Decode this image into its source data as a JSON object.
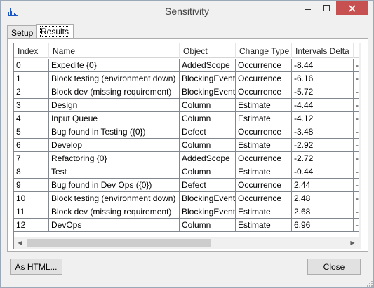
{
  "window": {
    "title": "Sensitivity",
    "icon": "bar-chart-app-icon",
    "controls": {
      "minimize": "minimize-icon",
      "maximize": "maximize-icon",
      "close": "close-icon"
    }
  },
  "tabs": [
    {
      "label": "Setup",
      "selected": false
    },
    {
      "label": "Results",
      "selected": true
    }
  ],
  "table": {
    "columns": [
      "Index",
      "Name",
      "Object",
      "Change Type",
      "Intervals Delta",
      ""
    ],
    "rows": [
      [
        "0",
        "Expedite {0}",
        "AddedScope",
        "Occurrence",
        "-8.44",
        "-"
      ],
      [
        "1",
        "Block testing (environment down)",
        "BlockingEvent",
        "Occurrence",
        "-6.16",
        "-"
      ],
      [
        "2",
        "Block dev (missing requirement)",
        "BlockingEvent",
        "Occurrence",
        "-5.72",
        "-"
      ],
      [
        "3",
        "Design",
        "Column",
        "Estimate",
        "-4.44",
        "-"
      ],
      [
        "4",
        "Input Queue",
        "Column",
        "Estimate",
        "-4.12",
        "-"
      ],
      [
        "5",
        "Bug found in Testing ({0})",
        "Defect",
        "Occurrence",
        "-3.48",
        "-"
      ],
      [
        "6",
        "Develop",
        "Column",
        "Estimate",
        "-2.92",
        "-"
      ],
      [
        "7",
        "Refactoring {0}",
        "AddedScope",
        "Occurrence",
        "-2.72",
        "-"
      ],
      [
        "8",
        "Test",
        "Column",
        "Estimate",
        "-0.44",
        "-"
      ],
      [
        "9",
        "Bug found in Dev Ops ({0})",
        "Defect",
        "Occurrence",
        "2.44",
        "-"
      ],
      [
        "10",
        "Block testing (environment down)",
        "BlockingEvent",
        "Occurrence",
        "2.48",
        "-"
      ],
      [
        "11",
        "Block dev (missing requirement)",
        "BlockingEvent",
        "Estimate",
        "2.68",
        "-"
      ],
      [
        "12",
        "DevOps",
        "Column",
        "Estimate",
        "6.96",
        "-"
      ]
    ]
  },
  "buttons": {
    "as_html": "As HTML...",
    "close": "Close"
  },
  "colors": {
    "close_button": "#c75050",
    "app_icon": "#1a56c8"
  }
}
